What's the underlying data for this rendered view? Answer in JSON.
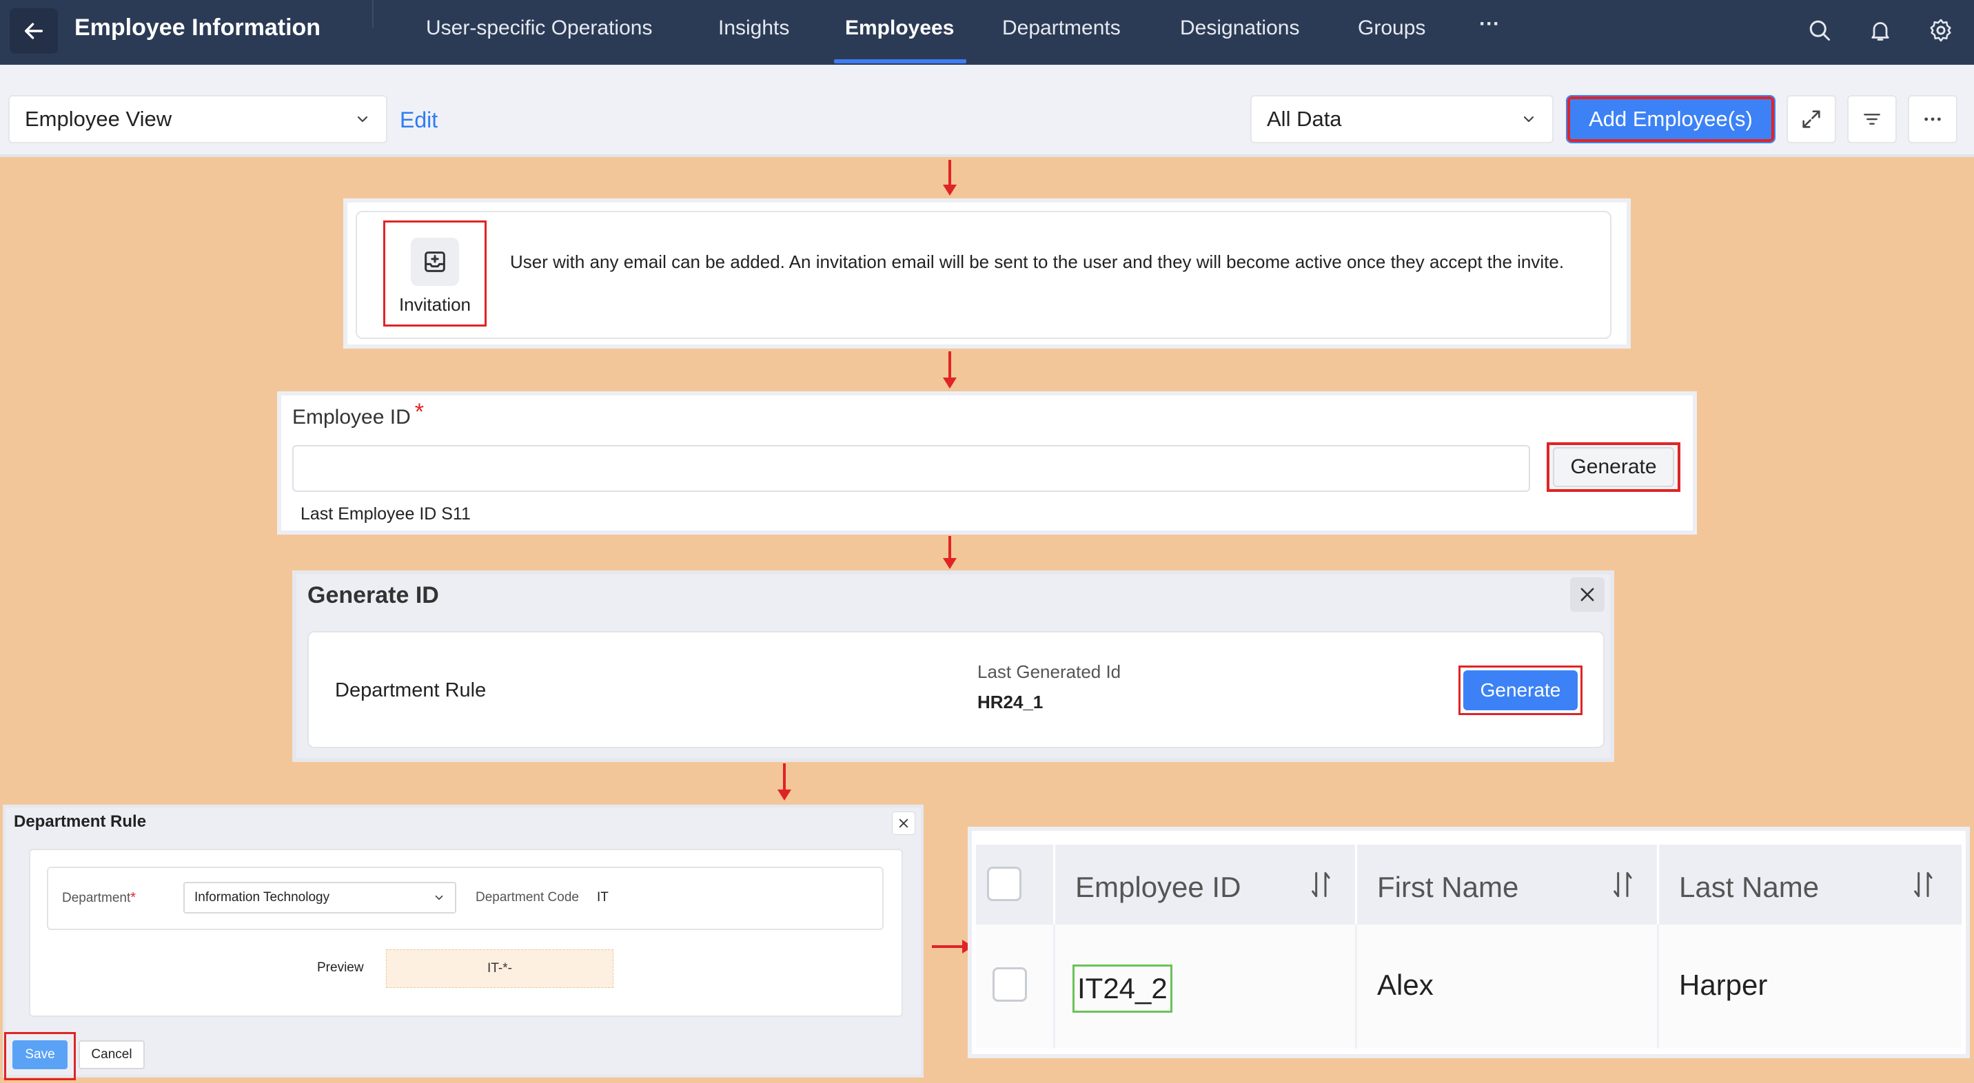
{
  "header": {
    "title": "Employee Information",
    "tabs": [
      {
        "label": "User-specific Operations"
      },
      {
        "label": "Insights"
      },
      {
        "label": "Employees"
      },
      {
        "label": "Departments"
      },
      {
        "label": "Designations"
      },
      {
        "label": "Groups"
      }
    ],
    "more_glyph": "···",
    "active_tab": "Employees"
  },
  "toolbar": {
    "view_select": "Employee View",
    "edit_label": "Edit",
    "data_filter": "All Data",
    "add_button": "Add Employee(s)"
  },
  "invitation": {
    "tile_label": "Invitation",
    "description": "User with any email can be added. An invitation email will be sent to the user and they will become active once they accept the invite."
  },
  "employee_id_form": {
    "label": "Employee ID",
    "required_mark": "*",
    "input_value": "",
    "generate_button": "Generate",
    "last_id_note": "Last Employee ID S11"
  },
  "generate_id_dialog": {
    "title": "Generate ID",
    "rule_label": "Department Rule",
    "last_generated_label": "Last Generated Id",
    "last_generated_value": "HR24_1",
    "generate_button": "Generate"
  },
  "department_rule_dialog": {
    "title": "Department Rule",
    "department_label": "Department",
    "required_mark": "*",
    "department_value": "Information Technology",
    "department_code_label": "Department Code",
    "department_code_value": "IT",
    "preview_label": "Preview",
    "preview_value": "IT-*-",
    "save_button": "Save",
    "cancel_button": "Cancel"
  },
  "employee_table": {
    "columns": [
      "Employee ID",
      "First Name",
      "Last Name"
    ],
    "rows": [
      {
        "employee_id": "IT24_2",
        "first_name": "Alex",
        "last_name": "Harper"
      }
    ]
  },
  "colors": {
    "nav_bg": "#2c3b55",
    "accent": "#3c82f6",
    "highlight": "#e02424",
    "canvas_bg": "#f3c699",
    "new_id_highlight": "#6ac259"
  },
  "icons": [
    "back-arrow-icon",
    "search-icon",
    "bell-icon",
    "gear-icon",
    "chevron-down-icon",
    "expand-icon",
    "filter-icon",
    "more-icon",
    "inbox-plus-icon",
    "close-icon",
    "sort-icon"
  ]
}
